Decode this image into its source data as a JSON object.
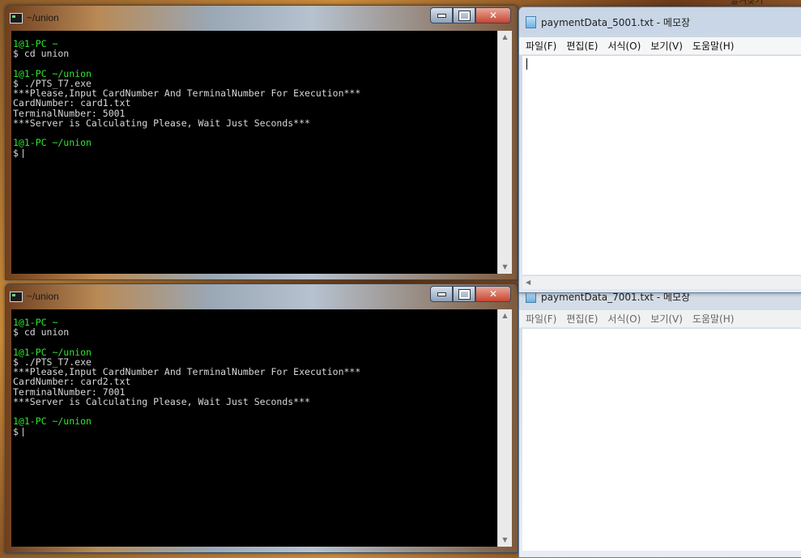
{
  "terminals": [
    {
      "title": "~/union",
      "lines": [
        {
          "text": "1@1-PC ~",
          "kind": "prompt"
        },
        {
          "text": "$ cd union",
          "kind": "out"
        },
        {
          "text": "1@1-PC ~/union",
          "kind": "prompt"
        },
        {
          "text": "$ ./PTS_T7.exe",
          "kind": "out"
        },
        {
          "text": "***Please,Input CardNumber And TerminalNumber For Execution***",
          "kind": "out"
        },
        {
          "text": "CardNumber: card1.txt",
          "kind": "out"
        },
        {
          "text": "TerminalNumber: 5001",
          "kind": "out"
        },
        {
          "text": "***Server is Calculating Please, Wait Just Seconds***",
          "kind": "out"
        },
        {
          "text": "1@1-PC ~/union",
          "kind": "prompt"
        },
        {
          "text": "$",
          "kind": "out"
        }
      ]
    },
    {
      "title": "~/union",
      "lines": [
        {
          "text": "1@1-PC ~",
          "kind": "prompt"
        },
        {
          "text": "$ cd union",
          "kind": "out"
        },
        {
          "text": "1@1-PC ~/union",
          "kind": "prompt"
        },
        {
          "text": "$ ./PTS_T7.exe",
          "kind": "out"
        },
        {
          "text": "***Please,Input CardNumber And TerminalNumber For Execution***",
          "kind": "out"
        },
        {
          "text": "CardNumber: card2.txt",
          "kind": "out"
        },
        {
          "text": "TerminalNumber: 7001",
          "kind": "out"
        },
        {
          "text": "***Server is Calculating Please, Wait Just Seconds***",
          "kind": "out"
        },
        {
          "text": "1@1-PC ~/union",
          "kind": "prompt"
        },
        {
          "text": "$",
          "kind": "out"
        }
      ]
    }
  ],
  "notepads": [
    {
      "title": "paymentData_5001.txt - 메모장",
      "menu": [
        "파일(F)",
        "편집(E)",
        "서식(O)",
        "보기(V)",
        "도움말(H)"
      ]
    },
    {
      "title": "paymentData_7001.txt - 메모장",
      "menu": [
        "파일(F)",
        "편집(E)",
        "서식(O)",
        "보기(V)",
        "도움말(H)"
      ]
    }
  ],
  "desktop": {
    "gadget_label": "즐겨찾기"
  },
  "icons": {
    "terminal_app": "terminal-icon",
    "notepad_app": "notepad-icon",
    "minimize": "minimize-icon",
    "maximize": "maximize-icon",
    "close": "close-icon"
  },
  "colors": {
    "prompt": "#2ee82e",
    "console_bg": "#000000",
    "close_button": "#c8452f"
  }
}
